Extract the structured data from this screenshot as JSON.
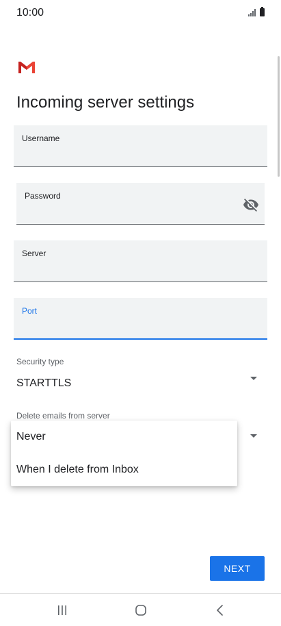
{
  "status_bar": {
    "time": "10:00",
    "icons": [
      "signal-icon",
      "battery-icon"
    ]
  },
  "app": {
    "logo": "gmail-logo-icon",
    "brand_colors": {
      "red": "#ea4335",
      "dark_red": "#c5221f"
    }
  },
  "page": {
    "title": "Incoming server settings"
  },
  "fields": {
    "username": {
      "label": "Username",
      "value": ""
    },
    "password": {
      "label": "Password",
      "value": "",
      "toggle_icon": "visibility-off-icon"
    },
    "server": {
      "label": "Server",
      "value": ""
    },
    "port": {
      "label": "Port",
      "value": "",
      "focused": true
    }
  },
  "security_type": {
    "label": "Security type",
    "selected": "STARTTLS"
  },
  "delete_emails": {
    "label": "Delete emails from server",
    "options": [
      "Never",
      "When I delete from Inbox"
    ]
  },
  "actions": {
    "next_label": "NEXT"
  },
  "nav": {
    "icons": [
      "recent-apps-icon",
      "home-icon",
      "back-icon"
    ]
  },
  "colors": {
    "accent": "#1a73e8",
    "field_bg": "#f1f3f4",
    "text": "#202124",
    "muted": "#5f6368"
  }
}
